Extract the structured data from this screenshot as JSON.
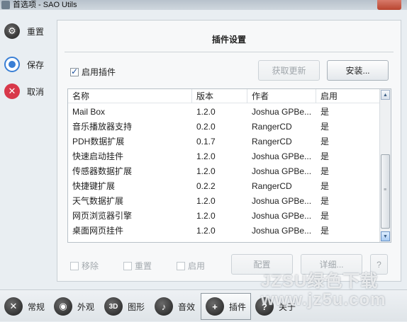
{
  "window": {
    "title": "首选项 - SAO Utils"
  },
  "sidebar": {
    "items": [
      {
        "label": "重置",
        "icon": "gear-icon"
      },
      {
        "label": "保存",
        "icon": "radio-icon"
      },
      {
        "label": "取消",
        "icon": "close-icon"
      }
    ]
  },
  "panel": {
    "title": "插件设置",
    "enable_plugins_label": "启用插件",
    "update_button": "获取更新",
    "install_button": "安装...",
    "table": {
      "headers": [
        "名称",
        "版本",
        "作者",
        "启用"
      ],
      "rows": [
        [
          "Mail Box",
          "1.2.0",
          "Joshua GPBe...",
          "是"
        ],
        [
          "音乐播放器支持",
          "0.2.0",
          "RangerCD",
          "是"
        ],
        [
          "PDH数据扩展",
          "0.1.7",
          "RangerCD",
          "是"
        ],
        [
          "快速启动挂件",
          "1.2.0",
          "Joshua GPBe...",
          "是"
        ],
        [
          "传感器数据扩展",
          "1.2.0",
          "Joshua GPBe...",
          "是"
        ],
        [
          "快捷键扩展",
          "0.2.2",
          "RangerCD",
          "是"
        ],
        [
          "天气数据扩展",
          "1.2.0",
          "Joshua GPBe...",
          "是"
        ],
        [
          "网页浏览器引擎",
          "1.2.0",
          "Joshua GPBe...",
          "是"
        ],
        [
          "桌面网页挂件",
          "1.2.0",
          "Joshua GPBe...",
          "是"
        ]
      ]
    },
    "remove_label": "移除",
    "reset_label": "重置",
    "enable_label": "启用",
    "config_button": "配置",
    "detail_button": "详细...",
    "help_button": "?"
  },
  "toolbar": {
    "items": [
      {
        "label": "常规",
        "icon": "wrench-icon"
      },
      {
        "label": "外观",
        "icon": "eye-icon"
      },
      {
        "label": "图形",
        "icon": "3d-icon"
      },
      {
        "label": "音效",
        "icon": "speaker-icon"
      },
      {
        "label": "插件",
        "icon": "plus-icon"
      },
      {
        "label": "关于",
        "icon": "question-icon"
      }
    ]
  },
  "watermark": {
    "line1": "JZSU绿色下载",
    "line2": "www.jz5u.com"
  }
}
